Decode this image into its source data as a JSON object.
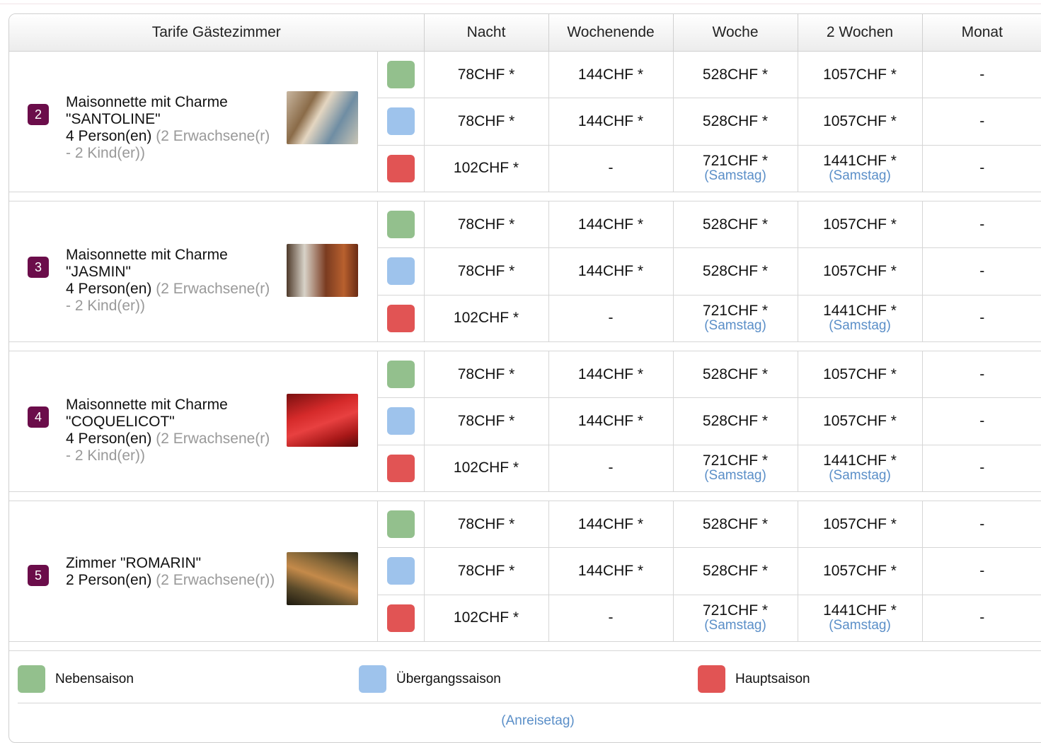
{
  "header": {
    "room_col": "Tarife Gästezimmer",
    "cols": [
      "Nacht",
      "Wochenende",
      "Woche",
      "2 Wochen",
      "Monat"
    ]
  },
  "rooms": [
    {
      "number": "2",
      "name": "Maisonnette mit Charme \"SANTOLINE\"",
      "persons": "4 Person(en)",
      "detail": "(2 Erwachsene(r) - 2 Kind(er))",
      "rates": [
        {
          "season": "Nebensaison",
          "nacht": "78CHF *",
          "wochenende": "144CHF *",
          "woche": "528CHF *",
          "woche_note": "",
          "zwei_wochen": "1057CHF *",
          "zwei_wochen_note": "",
          "monat": "-"
        },
        {
          "season": "Übergangssaison",
          "nacht": "78CHF *",
          "wochenende": "144CHF *",
          "woche": "528CHF *",
          "woche_note": "",
          "zwei_wochen": "1057CHF *",
          "zwei_wochen_note": "",
          "monat": "-"
        },
        {
          "season": "Hauptsaison",
          "nacht": "102CHF *",
          "wochenende": "-",
          "woche": "721CHF *",
          "woche_note": "(Samstag)",
          "zwei_wochen": "1441CHF *",
          "zwei_wochen_note": "(Samstag)",
          "monat": "-"
        }
      ]
    },
    {
      "number": "3",
      "name": "Maisonnette mit Charme \"JASMIN\"",
      "persons": "4 Person(en)",
      "detail": "(2 Erwachsene(r) - 2 Kind(er))",
      "rates": [
        {
          "season": "Nebensaison",
          "nacht": "78CHF *",
          "wochenende": "144CHF *",
          "woche": "528CHF *",
          "woche_note": "",
          "zwei_wochen": "1057CHF *",
          "zwei_wochen_note": "",
          "monat": "-"
        },
        {
          "season": "Übergangssaison",
          "nacht": "78CHF *",
          "wochenende": "144CHF *",
          "woche": "528CHF *",
          "woche_note": "",
          "zwei_wochen": "1057CHF *",
          "zwei_wochen_note": "",
          "monat": "-"
        },
        {
          "season": "Hauptsaison",
          "nacht": "102CHF *",
          "wochenende": "-",
          "woche": "721CHF *",
          "woche_note": "(Samstag)",
          "zwei_wochen": "1441CHF *",
          "zwei_wochen_note": "(Samstag)",
          "monat": "-"
        }
      ]
    },
    {
      "number": "4",
      "name": "Maisonnette mit Charme \"COQUELICOT\"",
      "persons": "4 Person(en)",
      "detail": "(2 Erwachsene(r) - 2 Kind(er))",
      "rates": [
        {
          "season": "Nebensaison",
          "nacht": "78CHF *",
          "wochenende": "144CHF *",
          "woche": "528CHF *",
          "woche_note": "",
          "zwei_wochen": "1057CHF *",
          "zwei_wochen_note": "",
          "monat": "-"
        },
        {
          "season": "Übergangssaison",
          "nacht": "78CHF *",
          "wochenende": "144CHF *",
          "woche": "528CHF *",
          "woche_note": "",
          "zwei_wochen": "1057CHF *",
          "zwei_wochen_note": "",
          "monat": "-"
        },
        {
          "season": "Hauptsaison",
          "nacht": "102CHF *",
          "wochenende": "-",
          "woche": "721CHF *",
          "woche_note": "(Samstag)",
          "zwei_wochen": "1441CHF *",
          "zwei_wochen_note": "(Samstag)",
          "monat": "-"
        }
      ]
    },
    {
      "number": "5",
      "name": "Zimmer \"ROMARIN\"",
      "persons": "2 Person(en)",
      "detail": "(2 Erwachsene(r))",
      "rates": [
        {
          "season": "Nebensaison",
          "nacht": "78CHF *",
          "wochenende": "144CHF *",
          "woche": "528CHF *",
          "woche_note": "",
          "zwei_wochen": "1057CHF *",
          "zwei_wochen_note": "",
          "monat": "-"
        },
        {
          "season": "Übergangssaison",
          "nacht": "78CHF *",
          "wochenende": "144CHF *",
          "woche": "528CHF *",
          "woche_note": "",
          "zwei_wochen": "1057CHF *",
          "zwei_wochen_note": "",
          "monat": "-"
        },
        {
          "season": "Hauptsaison",
          "nacht": "102CHF *",
          "wochenende": "-",
          "woche": "721CHF *",
          "woche_note": "(Samstag)",
          "zwei_wochen": "1441CHF *",
          "zwei_wochen_note": "(Samstag)",
          "monat": "-"
        }
      ]
    }
  ],
  "legend": {
    "items": [
      {
        "label": "Nebensaison",
        "color": "#93c08d"
      },
      {
        "label": "Übergangssaison",
        "color": "#9ec3ec"
      },
      {
        "label": "Hauptsaison",
        "color": "#e15454"
      }
    ],
    "footnote": "(Anreisetag)"
  },
  "colors": {
    "badge": "#6b0d4a",
    "link": "#5b8fc8"
  }
}
